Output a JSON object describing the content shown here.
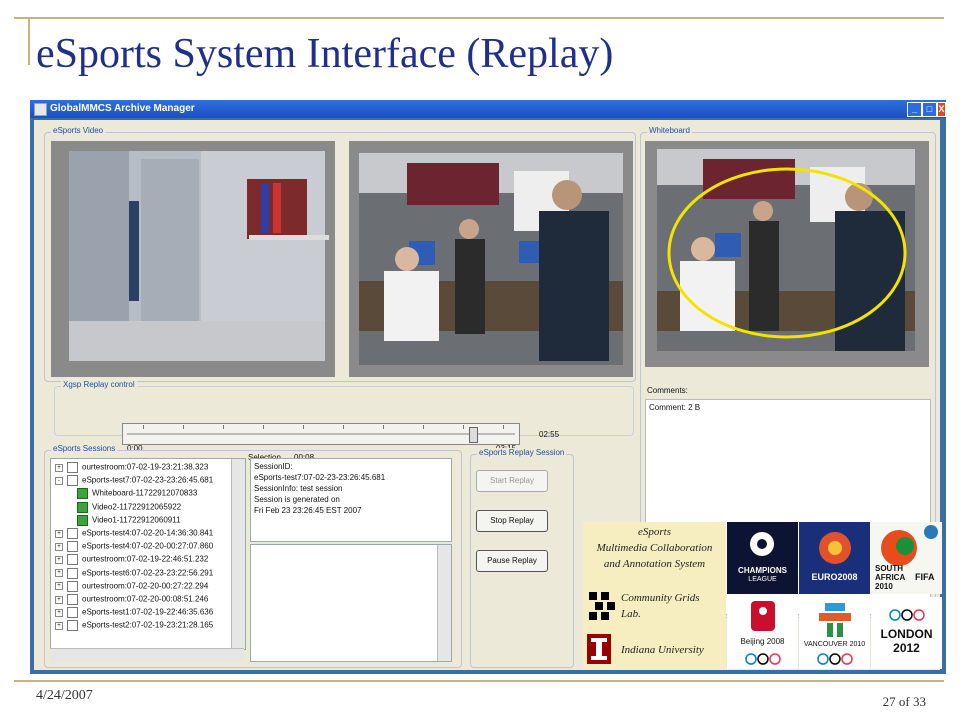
{
  "slide": {
    "title": "eSports System Interface (Replay)",
    "date": "4/24/2007",
    "page": "27 of 33"
  },
  "window": {
    "title": "GlobalMMCS Archive Manager",
    "buttons": [
      "_",
      "□",
      "X"
    ]
  },
  "video": {
    "group_label": "eSports Video"
  },
  "whiteboard": {
    "group_label": "Whiteboard",
    "comments_label": "Comments:",
    "comment": "Comment: 2 B"
  },
  "replay_control": {
    "group_label": "Xgsp Replay control",
    "start_time": "0:00",
    "selection_label": "Selection",
    "selection_value": "00:08",
    "end_time": "03:15",
    "total_time": "02:55",
    "position_fraction": 0.9
  },
  "sessions": {
    "group_label": "eSports Sessions",
    "items": [
      {
        "expander": "+",
        "label": "ourtestroom:07-02-19-23:21:38.323",
        "indent": 0,
        "kind": "folder"
      },
      {
        "expander": "-",
        "label": "eSports-test7:07-02-23-23:26:45.681",
        "indent": 0,
        "kind": "folder"
      },
      {
        "expander": "",
        "label": "Whiteboard-11722912070833",
        "indent": 1,
        "kind": "leaf"
      },
      {
        "expander": "",
        "label": "Video2-11722912065922",
        "indent": 1,
        "kind": "leaf"
      },
      {
        "expander": "",
        "label": "Video1-11722912060911",
        "indent": 1,
        "kind": "leaf"
      },
      {
        "expander": "+",
        "label": "eSports-test4:07-02-20-14:36:30.841",
        "indent": 0,
        "kind": "folder"
      },
      {
        "expander": "+",
        "label": "eSports-test4:07-02-20-00:27:07.860",
        "indent": 0,
        "kind": "folder"
      },
      {
        "expander": "+",
        "label": "ourtestroom:07-02-19-22:46:51.232",
        "indent": 0,
        "kind": "folder"
      },
      {
        "expander": "+",
        "label": "eSports-test6:07-02-23-23:22:56.291",
        "indent": 0,
        "kind": "folder"
      },
      {
        "expander": "+",
        "label": "ourtestroom:07-02-20-00:27:22.294",
        "indent": 0,
        "kind": "folder"
      },
      {
        "expander": "+",
        "label": "ourtestroom:07-02-20-00:08:51.246",
        "indent": 0,
        "kind": "folder"
      },
      {
        "expander": "+",
        "label": "eSports-test1:07-02-19-22:46:35.636",
        "indent": 0,
        "kind": "folder"
      },
      {
        "expander": "+",
        "label": "eSports-test2:07-02-19-23:21:28.165",
        "indent": 0,
        "kind": "folder"
      }
    ],
    "info_lines": [
      "SessionID:",
      "eSports-test7:07-02-23-23:26:45.681",
      "SessionInfo: test session",
      "Session is generated on",
      "Fri Feb 23 23:26:45 EST 2007"
    ]
  },
  "replay_session": {
    "group_label": "eSports Replay Session",
    "start_label": "Start Replay",
    "stop_label": "Stop Replay",
    "pause_label": "Pause Replay"
  },
  "logos": {
    "line1": "eSports",
    "line2": "Multimedia Collaboration",
    "line3": "and Annotation System",
    "cgl1": "Community Grids",
    "cgl2": "Lab.",
    "iu": "Indiana University",
    "ucl_line1": "CHAMPIONS",
    "ucl_line2": "LEAGUE",
    "euro": "EURO2008",
    "sa1": "SOUTH",
    "sa2": "AFRICA",
    "sa3": "2010",
    "fifa": "FIFA",
    "beijing": "Beijing 2008",
    "vancouver": "VANCOUVER 2010",
    "london1": "LONDON",
    "london2": "2012"
  }
}
